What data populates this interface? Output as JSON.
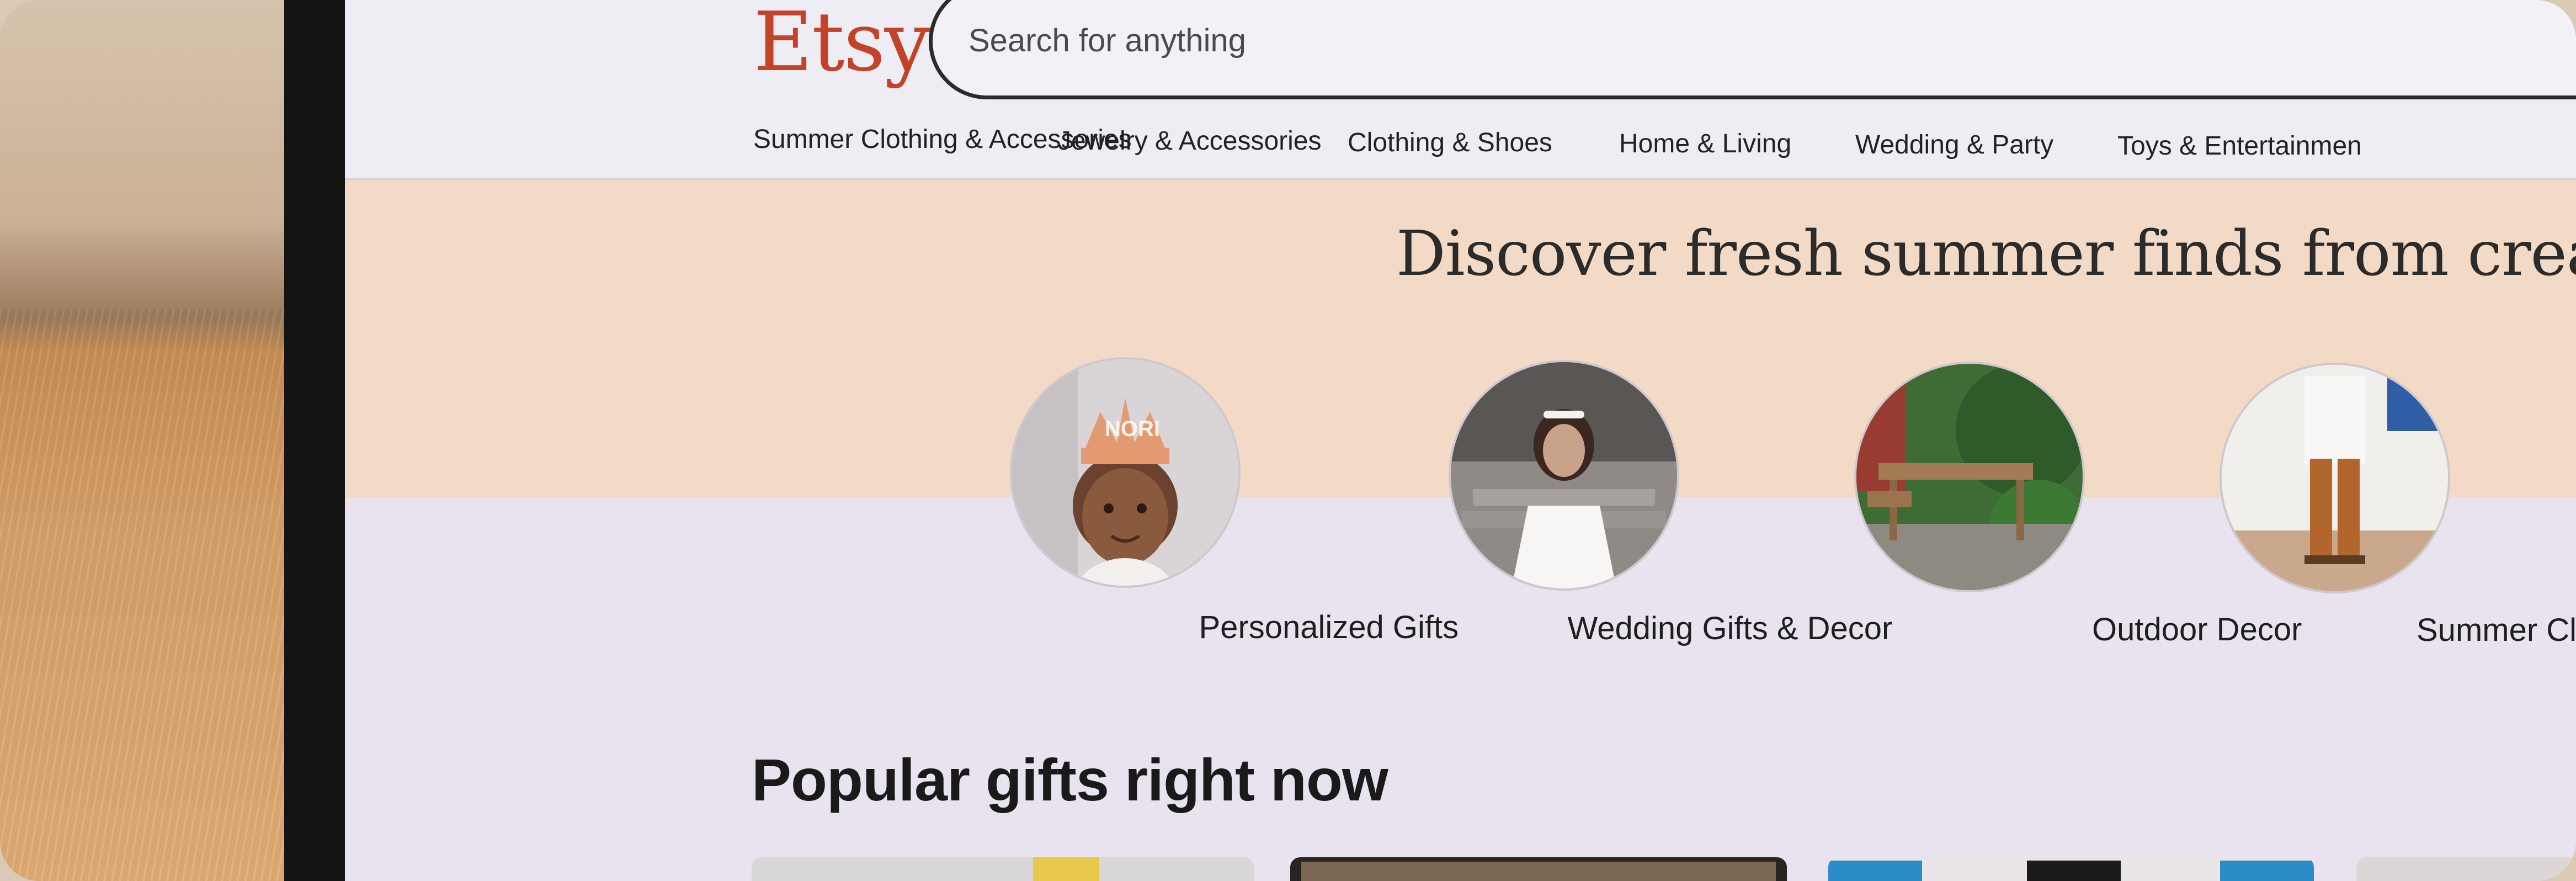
{
  "header": {
    "logo": "Etsy",
    "search_placeholder": "Search for anything"
  },
  "nav": {
    "items": [
      {
        "label": "Summer Clothing & Accessories"
      },
      {
        "label": "Jewelry & Accessories"
      },
      {
        "label": "Clothing & Shoes"
      },
      {
        "label": "Home & Living"
      },
      {
        "label": "Wedding & Party"
      },
      {
        "label": "Toys & Entertainmen"
      }
    ]
  },
  "banner": {
    "headline": "Discover fresh summer finds from creative s"
  },
  "categories": [
    {
      "label": "Personalized Gifts",
      "crown_text": "NORI"
    },
    {
      "label": "Wedding Gifts & Decor"
    },
    {
      "label": "Outdoor Decor"
    },
    {
      "label": "Summer Clothing"
    }
  ],
  "popular": {
    "title": "Popular gifts right now"
  },
  "colors": {
    "brand": "#c4422a",
    "banner_bg": "#f2dac6",
    "page_bg": "#e8e3ee"
  }
}
